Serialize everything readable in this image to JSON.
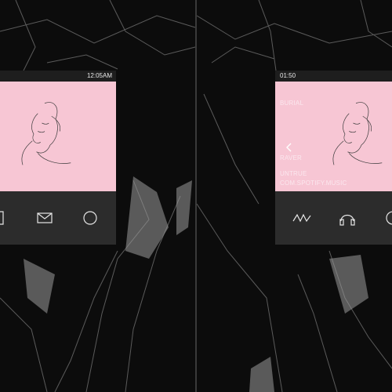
{
  "left_screen": {
    "status_time": "12:05AM",
    "dock_icons": [
      "phone-icon",
      "mail-icon",
      "circle-icon"
    ]
  },
  "right_screen": {
    "status_time": "01:50",
    "artist": "BURIAL",
    "track": "RAVER",
    "album": "UNTRUE",
    "source": "COM.SPOTIFY.MUSIC",
    "edge_label": "I",
    "dock_icons": [
      "waveform-icon",
      "headphones-icon",
      "circle-icon"
    ]
  },
  "colors": {
    "background": "#0c0c0c",
    "panel": "#2c2c2c",
    "artwork_pink": "#f7c6d4",
    "icon_white": "#e6e6e6"
  }
}
